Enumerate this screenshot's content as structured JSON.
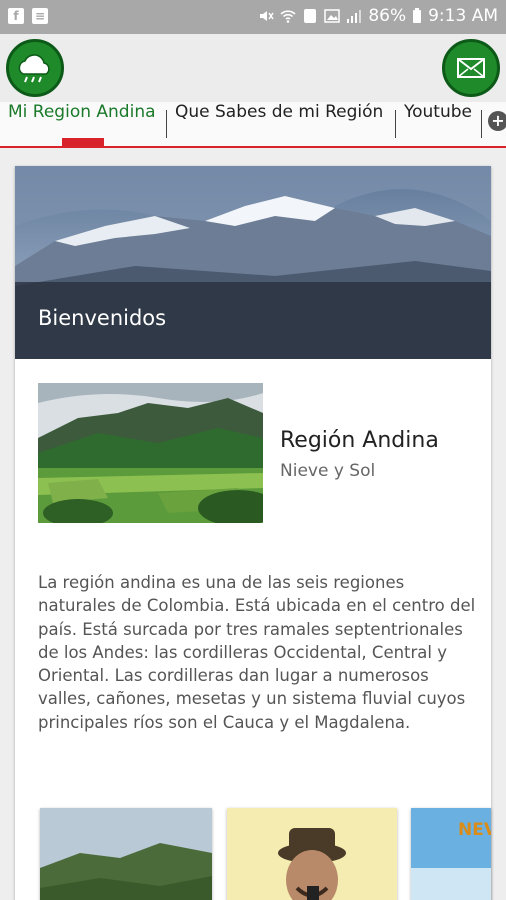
{
  "status_bar": {
    "battery": "86%",
    "time": "9:13 AM"
  },
  "toolbar": {
    "left_button_icon": "weather-cloud-icon",
    "right_button_icon": "envelope-icon"
  },
  "tabs": [
    {
      "label": "Mi Region Andina",
      "active": true
    },
    {
      "label": "Que Sabes de mi Región",
      "active": false
    },
    {
      "label": "Youtube",
      "active": false
    }
  ],
  "banner": {
    "title": "Bienvenidos"
  },
  "region": {
    "title": "Región Andina",
    "subtitle": "Nieve y Sol"
  },
  "description": "La región andina es una de las seis regiones naturales de Colombia. Está ubicada en el centro del país. Está surcada por tres ramales septentrionales de los Andes: las cordilleras Occidental, Central y Oriental. Las cordilleras dan lugar a numerosos valles, cañones, mesetas y un sistema fluvial cuyos principales ríos son el Cauca y el Magdalena.",
  "gallery": {
    "partial_label": "NEV"
  },
  "colors": {
    "accent_green": "#1a7a2a",
    "accent_red": "#d8232a",
    "button_green": "#1f8a2a"
  }
}
